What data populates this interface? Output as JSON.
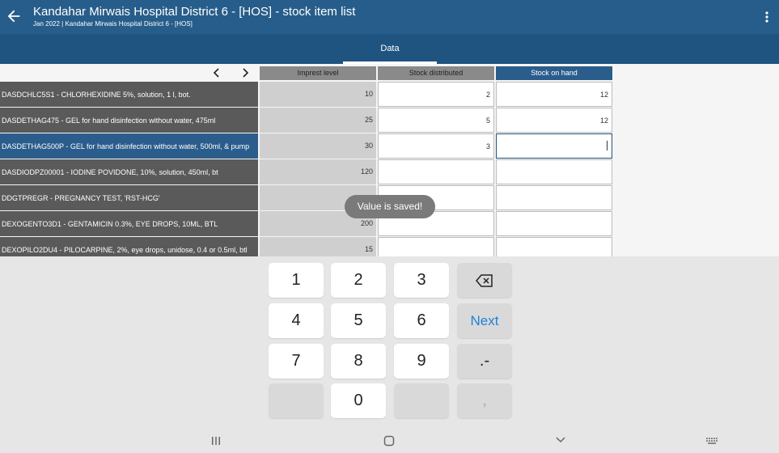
{
  "header": {
    "title": "Kandahar Mirwais Hospital District 6 -  [HOS] - stock item list",
    "subtitle": "Jan 2022 | Kandahar Mirwais Hospital District 6 - [HOS]",
    "back_icon": "arrow-left-icon",
    "menu_icon": "more-vertical-icon"
  },
  "tabs": [
    {
      "label": "Data",
      "selected": true
    }
  ],
  "table": {
    "columns": [
      "Imprest level",
      "Stock distributed",
      "Stock on hand"
    ],
    "rows": [
      {
        "label": "DASDCHLC5S1 - CHLORHEXIDINE 5%, solution, 1 l, bot.",
        "imprest": "10",
        "distributed": "2",
        "on_hand": "12"
      },
      {
        "label": "DASDETHAG475 - GEL for hand disinfection without water, 475ml",
        "imprest": "25",
        "distributed": "5",
        "on_hand": "12"
      },
      {
        "label": "DASDETHAG500P - GEL for hand disinfection without water, 500ml, & pump",
        "imprest": "30",
        "distributed": "3",
        "on_hand": ""
      },
      {
        "label": "DASDIODPZ00001 - IODINE POVIDONE, 10%, solution, 450ml, bt",
        "imprest": "120",
        "distributed": "",
        "on_hand": ""
      },
      {
        "label": "DDGTPREGR - PREGNANCY TEST, 'RST-HCG'",
        "imprest": "",
        "distributed": "",
        "on_hand": ""
      },
      {
        "label": "DEXOGENTO3D1 - GENTAMICIN 0.3%, EYE DROPS, 10ML, BTL",
        "imprest": "200",
        "distributed": "",
        "on_hand": ""
      },
      {
        "label": "DEXOPILO2DU4 - PILOCARPINE, 2%, eye drops, unidose, 0.4 or 0.5ml, btl",
        "imprest": "15",
        "distributed": "",
        "on_hand": ""
      }
    ]
  },
  "toast": "Value is saved!",
  "keypad": {
    "keys": [
      "1",
      "2",
      "3",
      "4",
      "5",
      "6",
      "7",
      "8",
      "9",
      "0"
    ],
    "next_label": "Next",
    "minus_label": ".-",
    "comma_label": ","
  },
  "colors": {
    "app_bar": "#275d8a",
    "tab_bar": "#1f5380",
    "selected_row": "#2b5d8c",
    "next_key": "#1e82d6"
  }
}
